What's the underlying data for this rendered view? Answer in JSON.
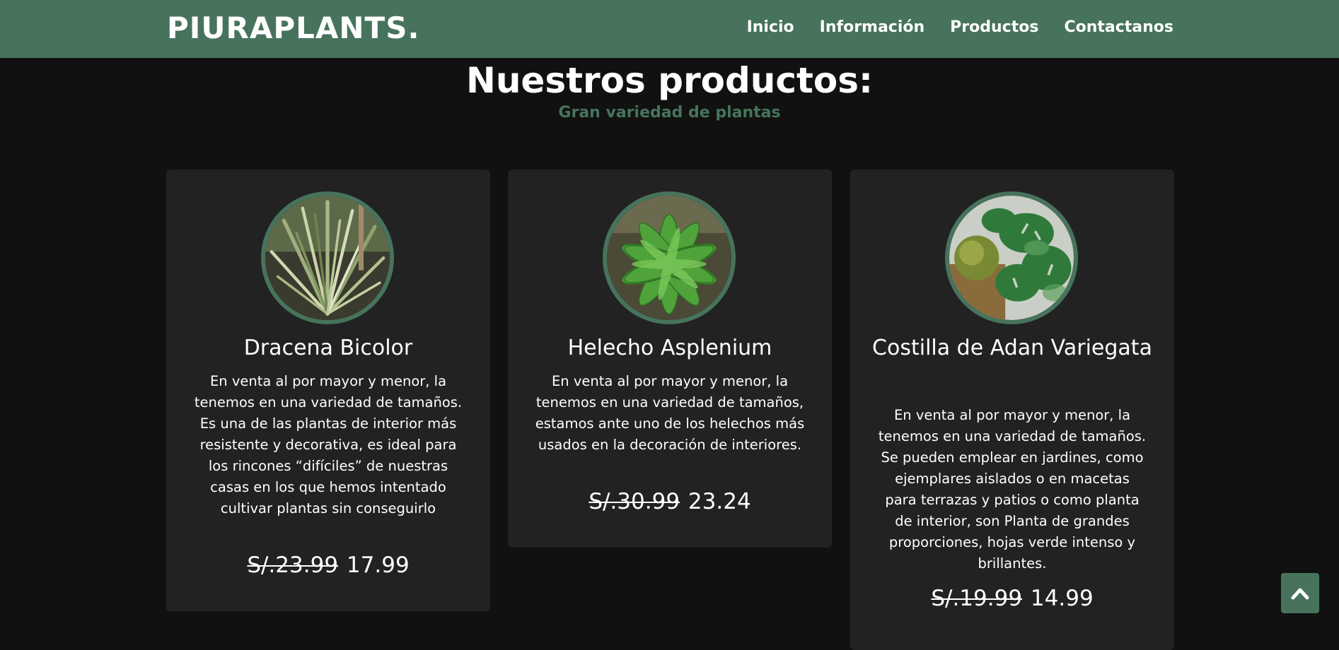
{
  "brand": "PIURAPLANTS.",
  "nav": {
    "items": [
      {
        "label": "Inicio"
      },
      {
        "label": "Información"
      },
      {
        "label": "Productos"
      },
      {
        "label": "Contactanos"
      }
    ]
  },
  "section": {
    "title": "Nuestros productos:",
    "subtitle": "Gran variedad de plantas"
  },
  "products": [
    {
      "name": "Dracena Bicolor",
      "description": "En venta al por mayor y menor, la tenemos en una variedad de tamaños. Es una de las plantas de interior más resistente y decorativa, es ideal para los rincones “difíciles” de nuestras casas en los que hemos intentado cultivar plantas sin conseguirlo",
      "old_price": "S/.23.99",
      "price": "17.99"
    },
    {
      "name": "Helecho Asplenium",
      "description": "En venta al por mayor y menor, la tenemos en una variedad de tamaños, estamos ante uno de los helechos más usados en la decoración de interiores.",
      "old_price": "S/.30.99",
      "price": "23.24"
    },
    {
      "name": "Costilla de Adan Variegata",
      "description": "En venta al por mayor y menor, la tenemos en una variedad de tamaños. Se pueden emplear en jardines, como ejemplares aislados o en macetas para terrazas y patios o como planta de interior, son Planta de grandes proporciones, hojas verde intenso y brillantes.",
      "old_price": "S/.19.99",
      "price": "14.99"
    }
  ],
  "scroll_top_icon": "chevron-up-icon",
  "colors": {
    "accent": "#47735c",
    "background": "#111111",
    "card": "#222222"
  }
}
